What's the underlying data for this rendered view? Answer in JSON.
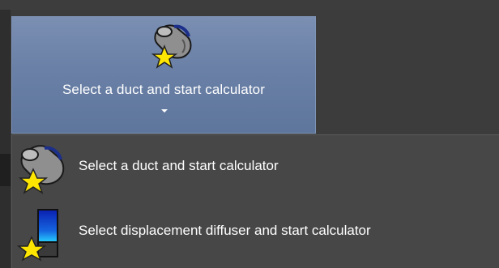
{
  "ribbon": {
    "split_button": {
      "label": "Select a duct and start calculator",
      "icon": "duct-star-icon",
      "arrow_icon": "dropdown-arrow-icon"
    }
  },
  "menu": {
    "items": [
      {
        "label": "Select a duct and start calculator",
        "icon": "duct-star-icon"
      },
      {
        "label": "Select displacement diffuser and start calculator",
        "icon": "diffuser-star-icon"
      }
    ]
  },
  "colors": {
    "button_face": "#6a80a6",
    "menu_bg": "#474747",
    "star_yellow": "#ffe600"
  }
}
